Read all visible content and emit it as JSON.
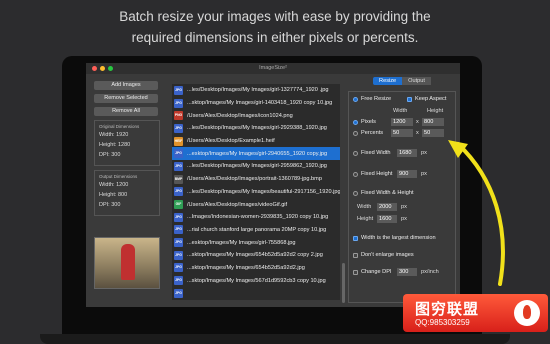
{
  "headline": [
    "Batch resize your images with ease by providing the",
    "required dimensions in either pixels or percents."
  ],
  "window_title": "ImageSize²",
  "buttons": {
    "add": "Add Images",
    "remove_selected": "Remove Selected",
    "remove_all": "Remove All"
  },
  "original": {
    "header": "Original Dimensions",
    "width": "Width: 1920",
    "height": "Height: 1280",
    "dpi": "DPI: 300"
  },
  "output": {
    "header": "Output Dimensions",
    "width": "Width: 1200",
    "height": "Height: 800",
    "dpi": "DPI: 300"
  },
  "files": [
    {
      "type": "JPG",
      "color": "#3a62c9",
      "name": "...les/Desktop/Images/My Images/girl-1327774_1920 .jpg"
    },
    {
      "type": "JPG",
      "color": "#3a62c9",
      "name": "...sktop/Images/My Images/girl-1403418_1920 copy 10.jpg"
    },
    {
      "type": "PNG",
      "color": "#c0392b",
      "name": "/Users/Alex/Desktop/Images/icon1024.png"
    },
    {
      "type": "JPG",
      "color": "#3a62c9",
      "name": "...les/Desktop/Images/My Images/girl-2929388_1920.jpg"
    },
    {
      "type": "HEIF",
      "color": "#e0922a",
      "name": "/Users/Alex/Desktop/Example1.heif"
    },
    {
      "type": "JPG",
      "color": "#3a62c9",
      "name": "...esktop/Images/My Images/girl-2940655_1920 copy.jpg",
      "selected": true
    },
    {
      "type": "JPG",
      "color": "#3a62c9",
      "name": "...les/Desktop/Images/My Images/girl-2959862_1920.jpg"
    },
    {
      "type": "BMP",
      "color": "#555555",
      "name": "/Users/Alex/Desktop/Images/portrait-1360789-jpg.bmp"
    },
    {
      "type": "JPG",
      "color": "#3a62c9",
      "name": "...les/Desktop/Images/My Images/beautiful-2917156_1920.jpg"
    },
    {
      "type": "GIF",
      "color": "#2f9e55",
      "name": "/Users/Alex/Desktop/Images/videoGif.gif"
    },
    {
      "type": "JPG",
      "color": "#3a62c9",
      "name": "...Images/Indonesian-women-2939835_1920 copy 10.jpg"
    },
    {
      "type": "JPG",
      "color": "#3a62c9",
      "name": "...rial church stanford large panorama 20MP copy 10.jpg"
    },
    {
      "type": "JPG",
      "color": "#3a62c9",
      "name": "...esktop/Images/My Images/girl-755868.jpg"
    },
    {
      "type": "JPG",
      "color": "#3a62c9",
      "name": "...sktop/Images/My Images/654b52d5a92d2 copy 2.jpg"
    },
    {
      "type": "JPG",
      "color": "#3a62c9",
      "name": "...sktop/Images/My Images/654b52d5a92d2.jpg"
    },
    {
      "type": "JPG",
      "color": "#3a62c9",
      "name": "...sktop/Images/My Images/567d1d9592cb3 copy 10.jpg"
    },
    {
      "type": "JPG",
      "color": "#3a62c9",
      "name": ""
    }
  ],
  "tabs": [
    "Resize",
    "Output"
  ],
  "resize": {
    "free_resize": "Free Resize",
    "keep_aspect": "Keep Aspect",
    "col_width": "Width",
    "col_height": "Height",
    "pixels": "Pixels",
    "px_width": "1200",
    "x1": "x",
    "px_height": "800",
    "percents": "Percents",
    "pct_width": "50",
    "x2": "x",
    "pct_height": "50",
    "fixed_width": "Fixed Width",
    "fixed_width_val": "1680",
    "px1": "px",
    "fixed_height": "Fixed Height",
    "fixed_height_val": "900",
    "px2": "px",
    "fixed_wh": "Fixed Width & Height",
    "fwh_width_label": "Width",
    "fwh_width_val": "2000",
    "px3": "px",
    "fwh_height_label": "Height",
    "fwh_height_val": "1600",
    "px4": "px",
    "width_largest": "Width is the largest dimension",
    "dont_enlarge": "Don't enlarge images",
    "change_dpi": "Change DPI",
    "dpi_val": "300",
    "px_inch": "px/inch"
  },
  "watermark": {
    "title": "图穷联盟",
    "qq": "QQ:985303259"
  },
  "colors": {
    "accent": "#1e6fd0",
    "arrow": "#f1e11a",
    "watermark": "#e8321e"
  }
}
